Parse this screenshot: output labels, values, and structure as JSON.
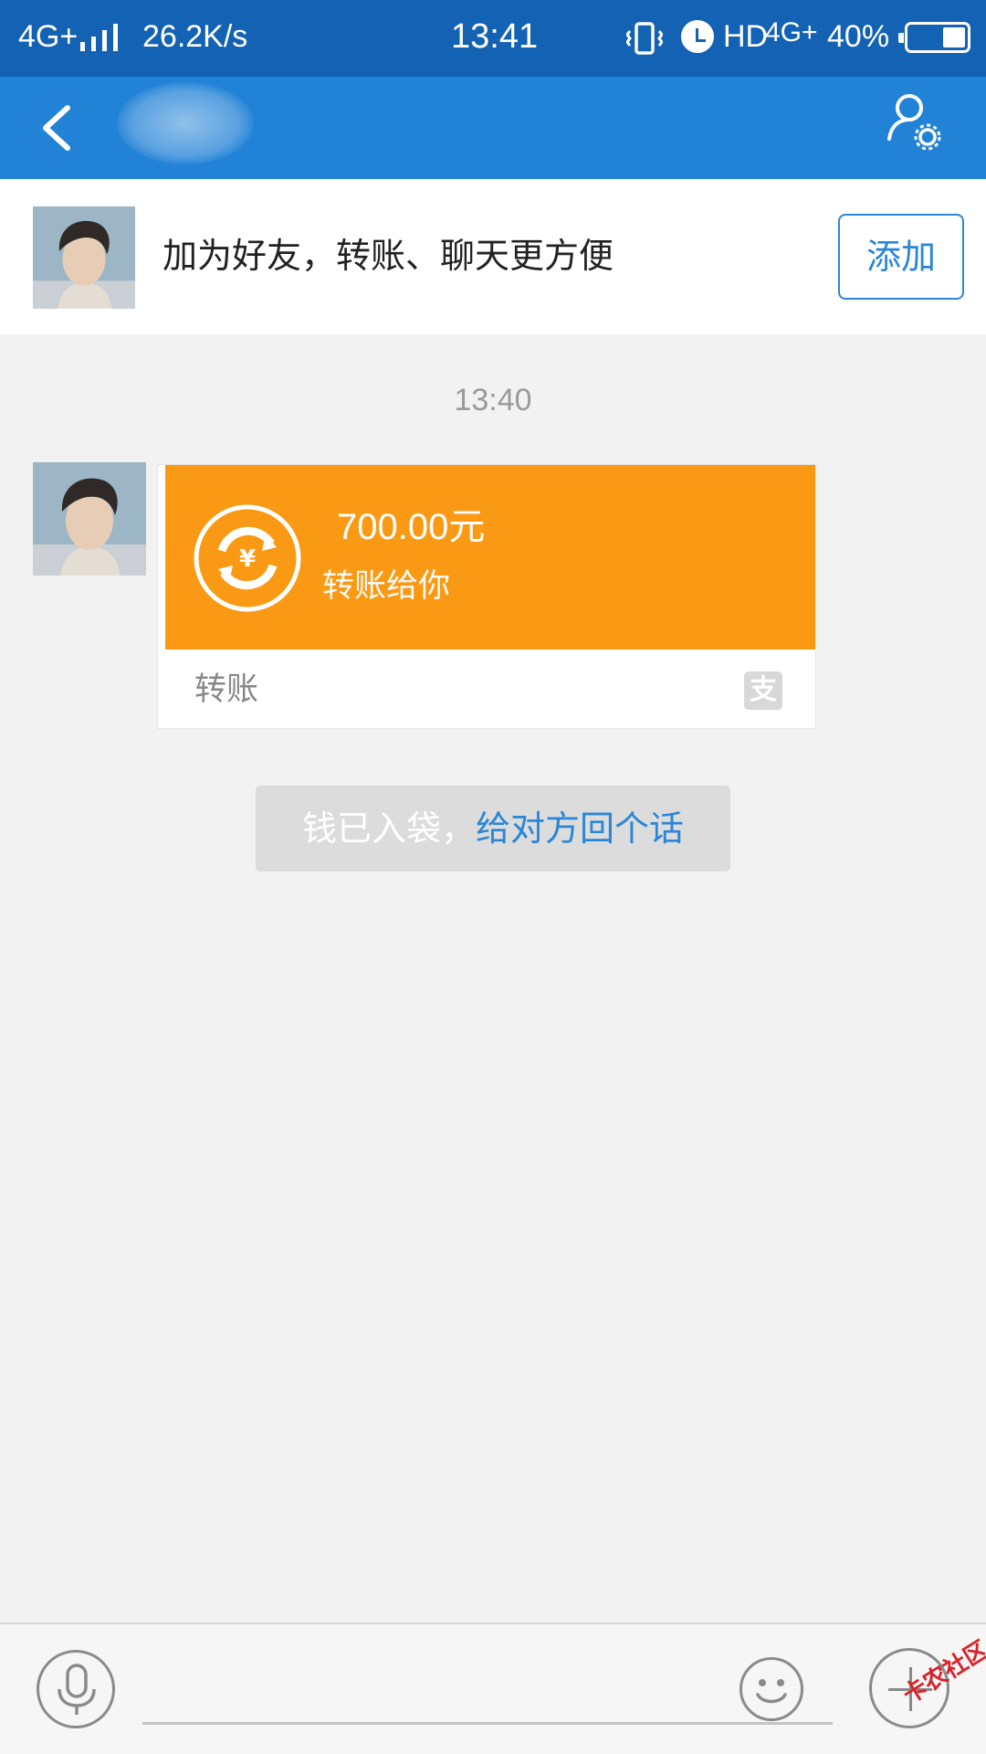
{
  "status_bar": {
    "network": "4G+",
    "speed": "26.2K/s",
    "time": "13:41",
    "hd": "HD",
    "network2": "4G+",
    "battery_text": "40%",
    "battery_level": 0.4,
    "icons": [
      "signal-icon",
      "vibrate-icon",
      "alarm-icon",
      "battery-icon"
    ]
  },
  "nav": {
    "back_icon": "chevron-left-icon",
    "settings_icon": "user-settings-icon"
  },
  "banner": {
    "text": "加为好友，转账、聊天更方便",
    "add_label": "添加"
  },
  "chat": {
    "timestamp": "13:40",
    "transfer": {
      "amount": "700.00元",
      "note": "转账给你",
      "label": "转账",
      "brand_glyph": "支",
      "accent": "#fa9a14"
    },
    "received_note": {
      "plain": "钱已入袋，",
      "link": "给对方回个话"
    }
  },
  "input_bar": {
    "voice_icon": "microphone-icon",
    "emoji_icon": "smiley-icon",
    "plus_icon": "plus-icon",
    "input_value": ""
  },
  "watermark": "卡农社区",
  "colors": {
    "status_bar": "#1462b3",
    "nav_bar": "#2182d6",
    "link": "#2a86d6",
    "transfer": "#fa9a14",
    "background": "#f2f2f2"
  }
}
